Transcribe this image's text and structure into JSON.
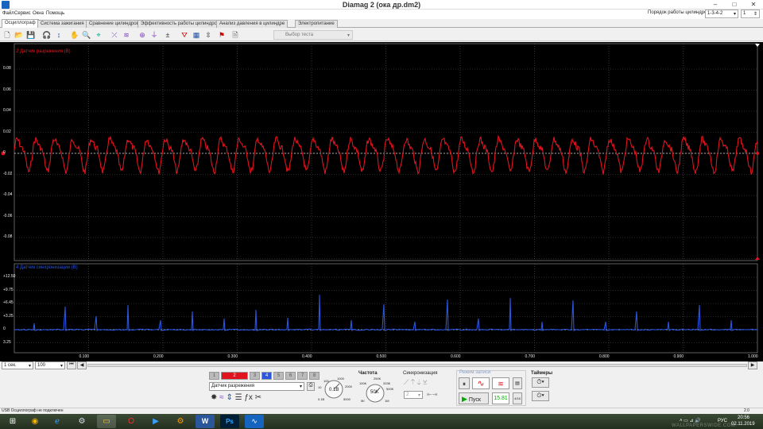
{
  "window": {
    "title": "Diamag 2 (ока др.dm2)",
    "minimize": "–",
    "maximize": "□",
    "close": "✕"
  },
  "menu": [
    "Файл",
    "Сервис",
    "Окна",
    "Помощь"
  ],
  "cylinder_order": {
    "label": "Порядок работы цилиндров",
    "value": "1-3-4-2",
    "count": "1"
  },
  "tabs": [
    "Осциллограф",
    "Система зажигания",
    "Сравнение цилиндров",
    "Эффективность работы цилиндров",
    "Анализ давления в цилиндре",
    "Электропитание"
  ],
  "active_tab": 0,
  "test_select": {
    "placeholder": "Выбор теста"
  },
  "channel1": {
    "label": "2 Датчик разрежения (В)",
    "color": "#e0141e",
    "yticks": [
      "0.08",
      "0.06",
      "0.04",
      "0.02",
      "0",
      "-0.02",
      "-0.04",
      "-0.06",
      "-0.08"
    ]
  },
  "channel2": {
    "label": "4 Датчик синхронизации (В)",
    "color": "#2a55e0",
    "yticks": [
      "+12.50",
      "+9.75",
      "+6.45",
      "+3.25",
      "0",
      "3.25"
    ]
  },
  "xticks": [
    "0.100",
    "0.200",
    "0.300",
    "0.400",
    "0.500",
    "0.600",
    "0.700",
    "0.800",
    "0.900",
    "1.000"
  ],
  "controls": {
    "timebase": "1 сек.",
    "scale": "100",
    "channel_buttons": [
      "1",
      "2",
      "3",
      "4",
      "5",
      "6",
      "7",
      "8"
    ],
    "sensor_name": "Датчик разрежения",
    "voltage_dial": {
      "center": "0.1В",
      "marks": [
        "100",
        "1000",
        "2000",
        "5000",
        "10",
        "0.1В"
      ]
    },
    "frequency": {
      "title": "Частота",
      "center": "50K",
      "marks": [
        "250K",
        "333K",
        "500K",
        "100K",
        "1M",
        "5K"
      ]
    },
    "sync": {
      "title": "Синхронизация",
      "value": "2"
    },
    "record_mode": {
      "title": "Режим записи",
      "start": "Пуск",
      "speed": "15.81",
      "count": "4/16"
    },
    "timers": {
      "title": "Таймеры"
    }
  },
  "status": {
    "left": "USB Осциллограф не подключен",
    "right": "2.0"
  },
  "taskbar": {
    "lang": "РУС",
    "time": "20:56",
    "date": "02.11.2019",
    "watermark": "WALLPAPERSWIDE.COM",
    "apps": [
      "windows-start",
      "chrome",
      "ie",
      "steam",
      "explorer",
      "opera",
      "media",
      "settings",
      "word",
      "photoshop",
      "diamag"
    ]
  }
}
